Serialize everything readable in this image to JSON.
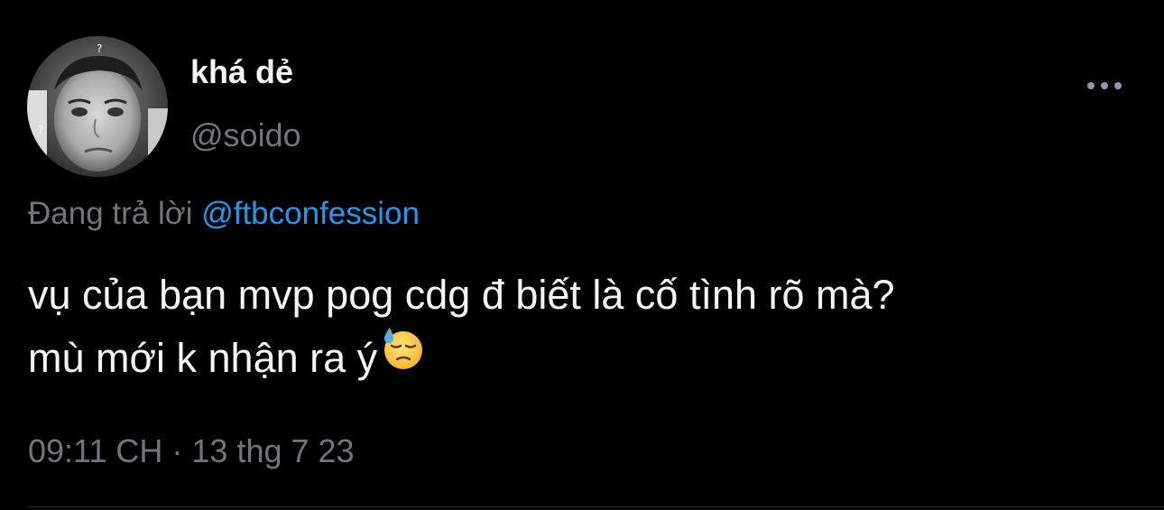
{
  "author": {
    "display_name": "khá dẻ",
    "handle": "@soido"
  },
  "more_icon": "more-horizontal-icon",
  "reply": {
    "prefix": "Đang trả lời",
    "handle": "@ftbconfession"
  },
  "tweet": {
    "lines": [
      "vụ của bạn mvp pog cdg đ biết là cố tình rõ mà?",
      "mù mới k nhận ra ý"
    ],
    "emoji": "downcast-face-with-sweat"
  },
  "timestamp": "09:11 CH · 13 thg 7 23",
  "colors": {
    "background": "#000000",
    "text": "#f5f5f5",
    "secondary": "#71767b",
    "link": "#1d9bf0",
    "divider": "#2f3336"
  }
}
